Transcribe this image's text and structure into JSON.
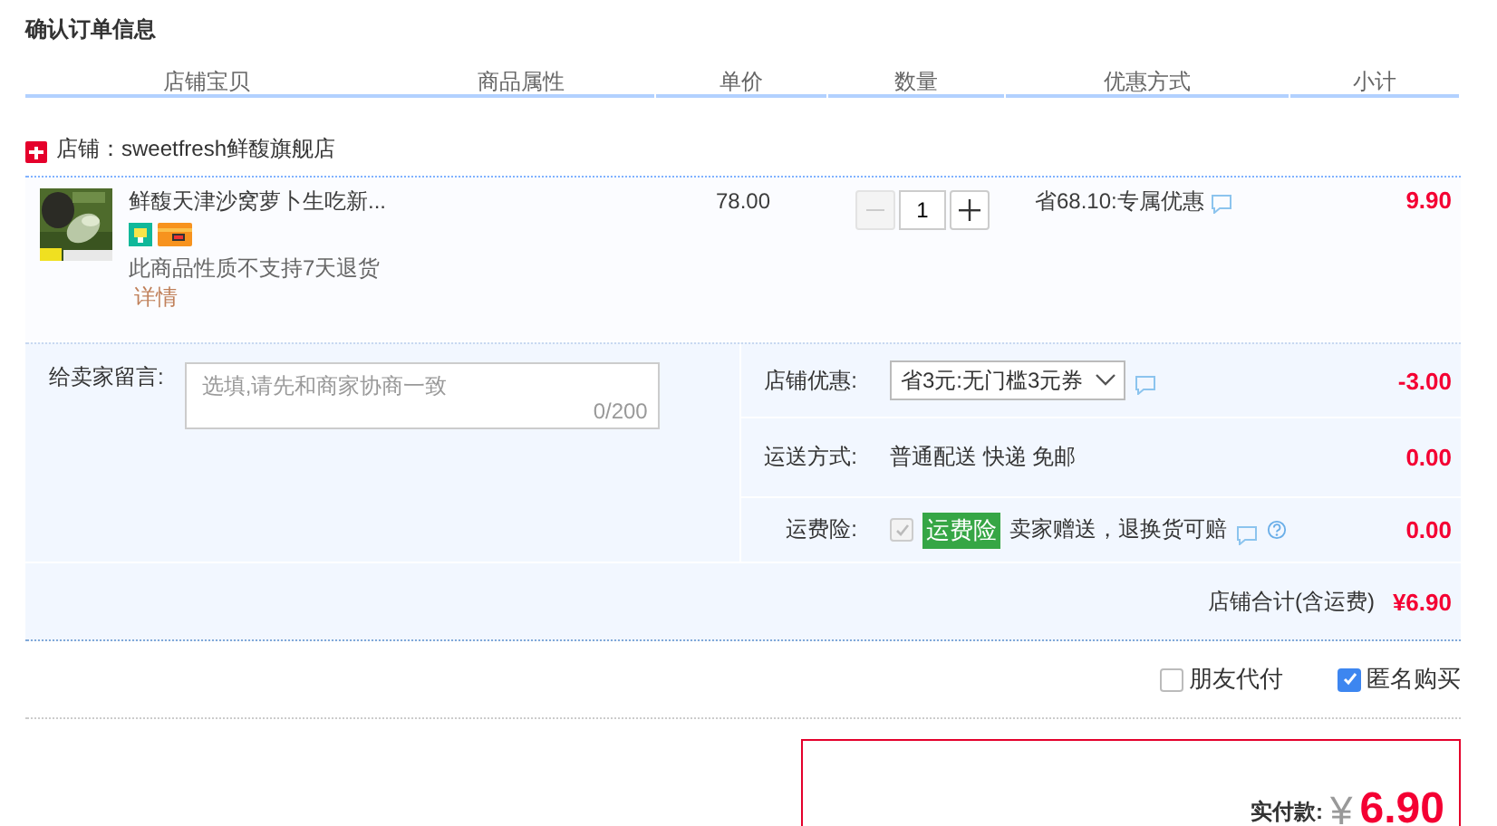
{
  "title": "确认订单信息",
  "columns": [
    "店铺宝贝",
    "商品属性",
    "单价",
    "数量",
    "优惠方式",
    "小计"
  ],
  "shop": {
    "name": "店铺：sweetfresh鲜馥旗舰店"
  },
  "item": {
    "kind": "picture",
    "name": "鲜馥天津沙窝萝卜生吃新...",
    "notice": "此商品性质不支持7天退货",
    "detail": "详情",
    "price": "78.00",
    "quantity": "1",
    "minus_disabled": true,
    "discount": "省68.10:专属优惠",
    "subtotal": "9.90"
  },
  "message": {
    "label": "给卖家留言:",
    "placeholder": "选填,请先和商家协商一致",
    "counter": "0/200"
  },
  "options": [
    {
      "kind": "select",
      "label": "店铺优惠:",
      "value": "省3元:无门槛3元券",
      "amount": "-3.00"
    },
    {
      "kind": "text",
      "label": "运送方式:",
      "value": "普通配送 快递 免邮",
      "amount": "0.00"
    },
    {
      "kind": "insurance",
      "label": "运费险:",
      "checked": true,
      "disabled": true,
      "tag": "运费险",
      "value": "卖家赠送，退换货可赔",
      "amount": "0.00"
    }
  ],
  "shop_total": {
    "label": "店铺合计(含运费)",
    "value": "¥6.90"
  },
  "checks": [
    {
      "label": "朋友代付",
      "checked": false
    },
    {
      "label": "匿名购买",
      "checked": true
    }
  ],
  "payment": {
    "label": "实付款:",
    "currency": "¥",
    "amount": "6.90"
  }
}
